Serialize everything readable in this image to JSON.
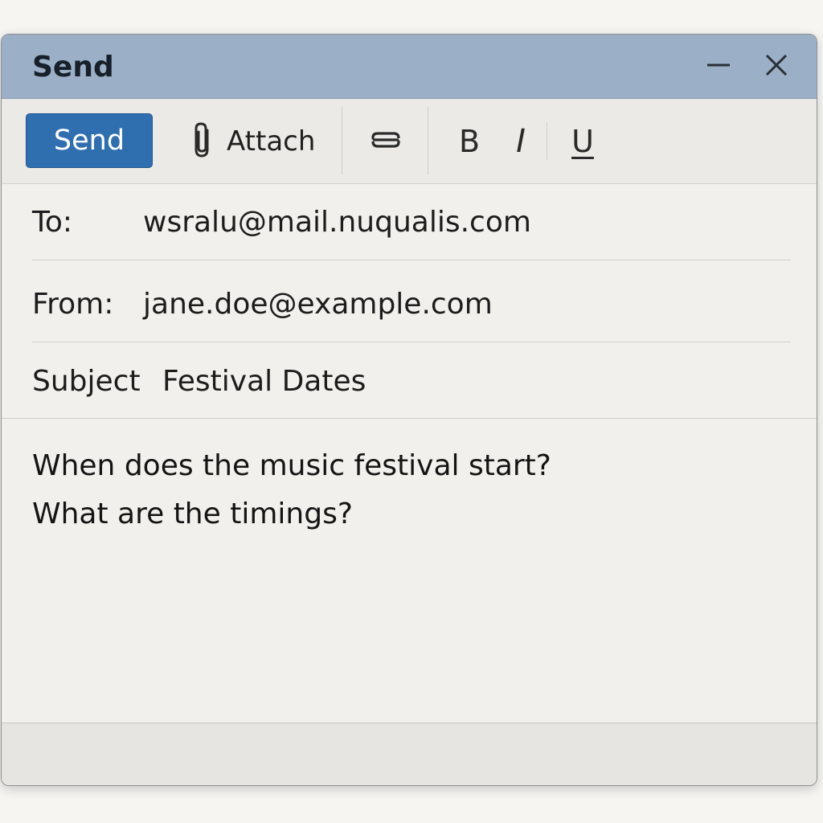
{
  "window": {
    "title": "Send",
    "minimize_icon": "minimize-icon",
    "close_icon": "close-icon"
  },
  "toolbar": {
    "send_label": "Send",
    "attach_label": "Attach",
    "attach_icon": "paperclip-icon",
    "link_icon": "link-icon",
    "bold_label": "B",
    "italic_label": "I",
    "underline_label": "U"
  },
  "fields": {
    "to_label": "To:",
    "to_value": "wsralu@mail.nuqualis.com",
    "from_label": "From:",
    "from_value": "jane.doe@example.com",
    "subject_label": "Subject",
    "subject_value": "Festival Dates"
  },
  "body": {
    "lines": [
      "When does the music festival start?",
      "What are the timings?"
    ]
  },
  "colors": {
    "titlebar": "#9bafc6",
    "send_button": "#2f6fb0",
    "background": "#f1f0ec"
  }
}
